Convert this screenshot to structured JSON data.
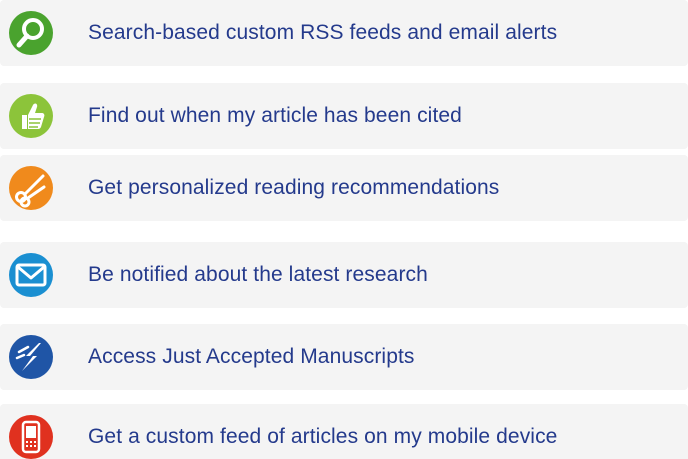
{
  "features": [
    {
      "label": "Search-based custom RSS feeds and email alerts",
      "icon": "search-icon",
      "color": "#4aa32e"
    },
    {
      "label": "Find out when my article has been cited",
      "icon": "thumbs-up-icon",
      "color": "#8cc43a"
    },
    {
      "label": "Get personalized reading recommendations",
      "icon": "scissors-icon",
      "color": "#f08a1c"
    },
    {
      "label": "Be notified about the latest research",
      "icon": "envelope-icon",
      "color": "#1a8fd1"
    },
    {
      "label": "Access Just Accepted Manuscripts",
      "icon": "lightning-icon",
      "color": "#1f55a6"
    },
    {
      "label": "Get a custom feed of articles on my mobile device",
      "icon": "mobile-phone-icon",
      "color": "#e0311f"
    }
  ],
  "colors": {
    "text": "#243a8c",
    "row_background": "#f4f4f4"
  }
}
